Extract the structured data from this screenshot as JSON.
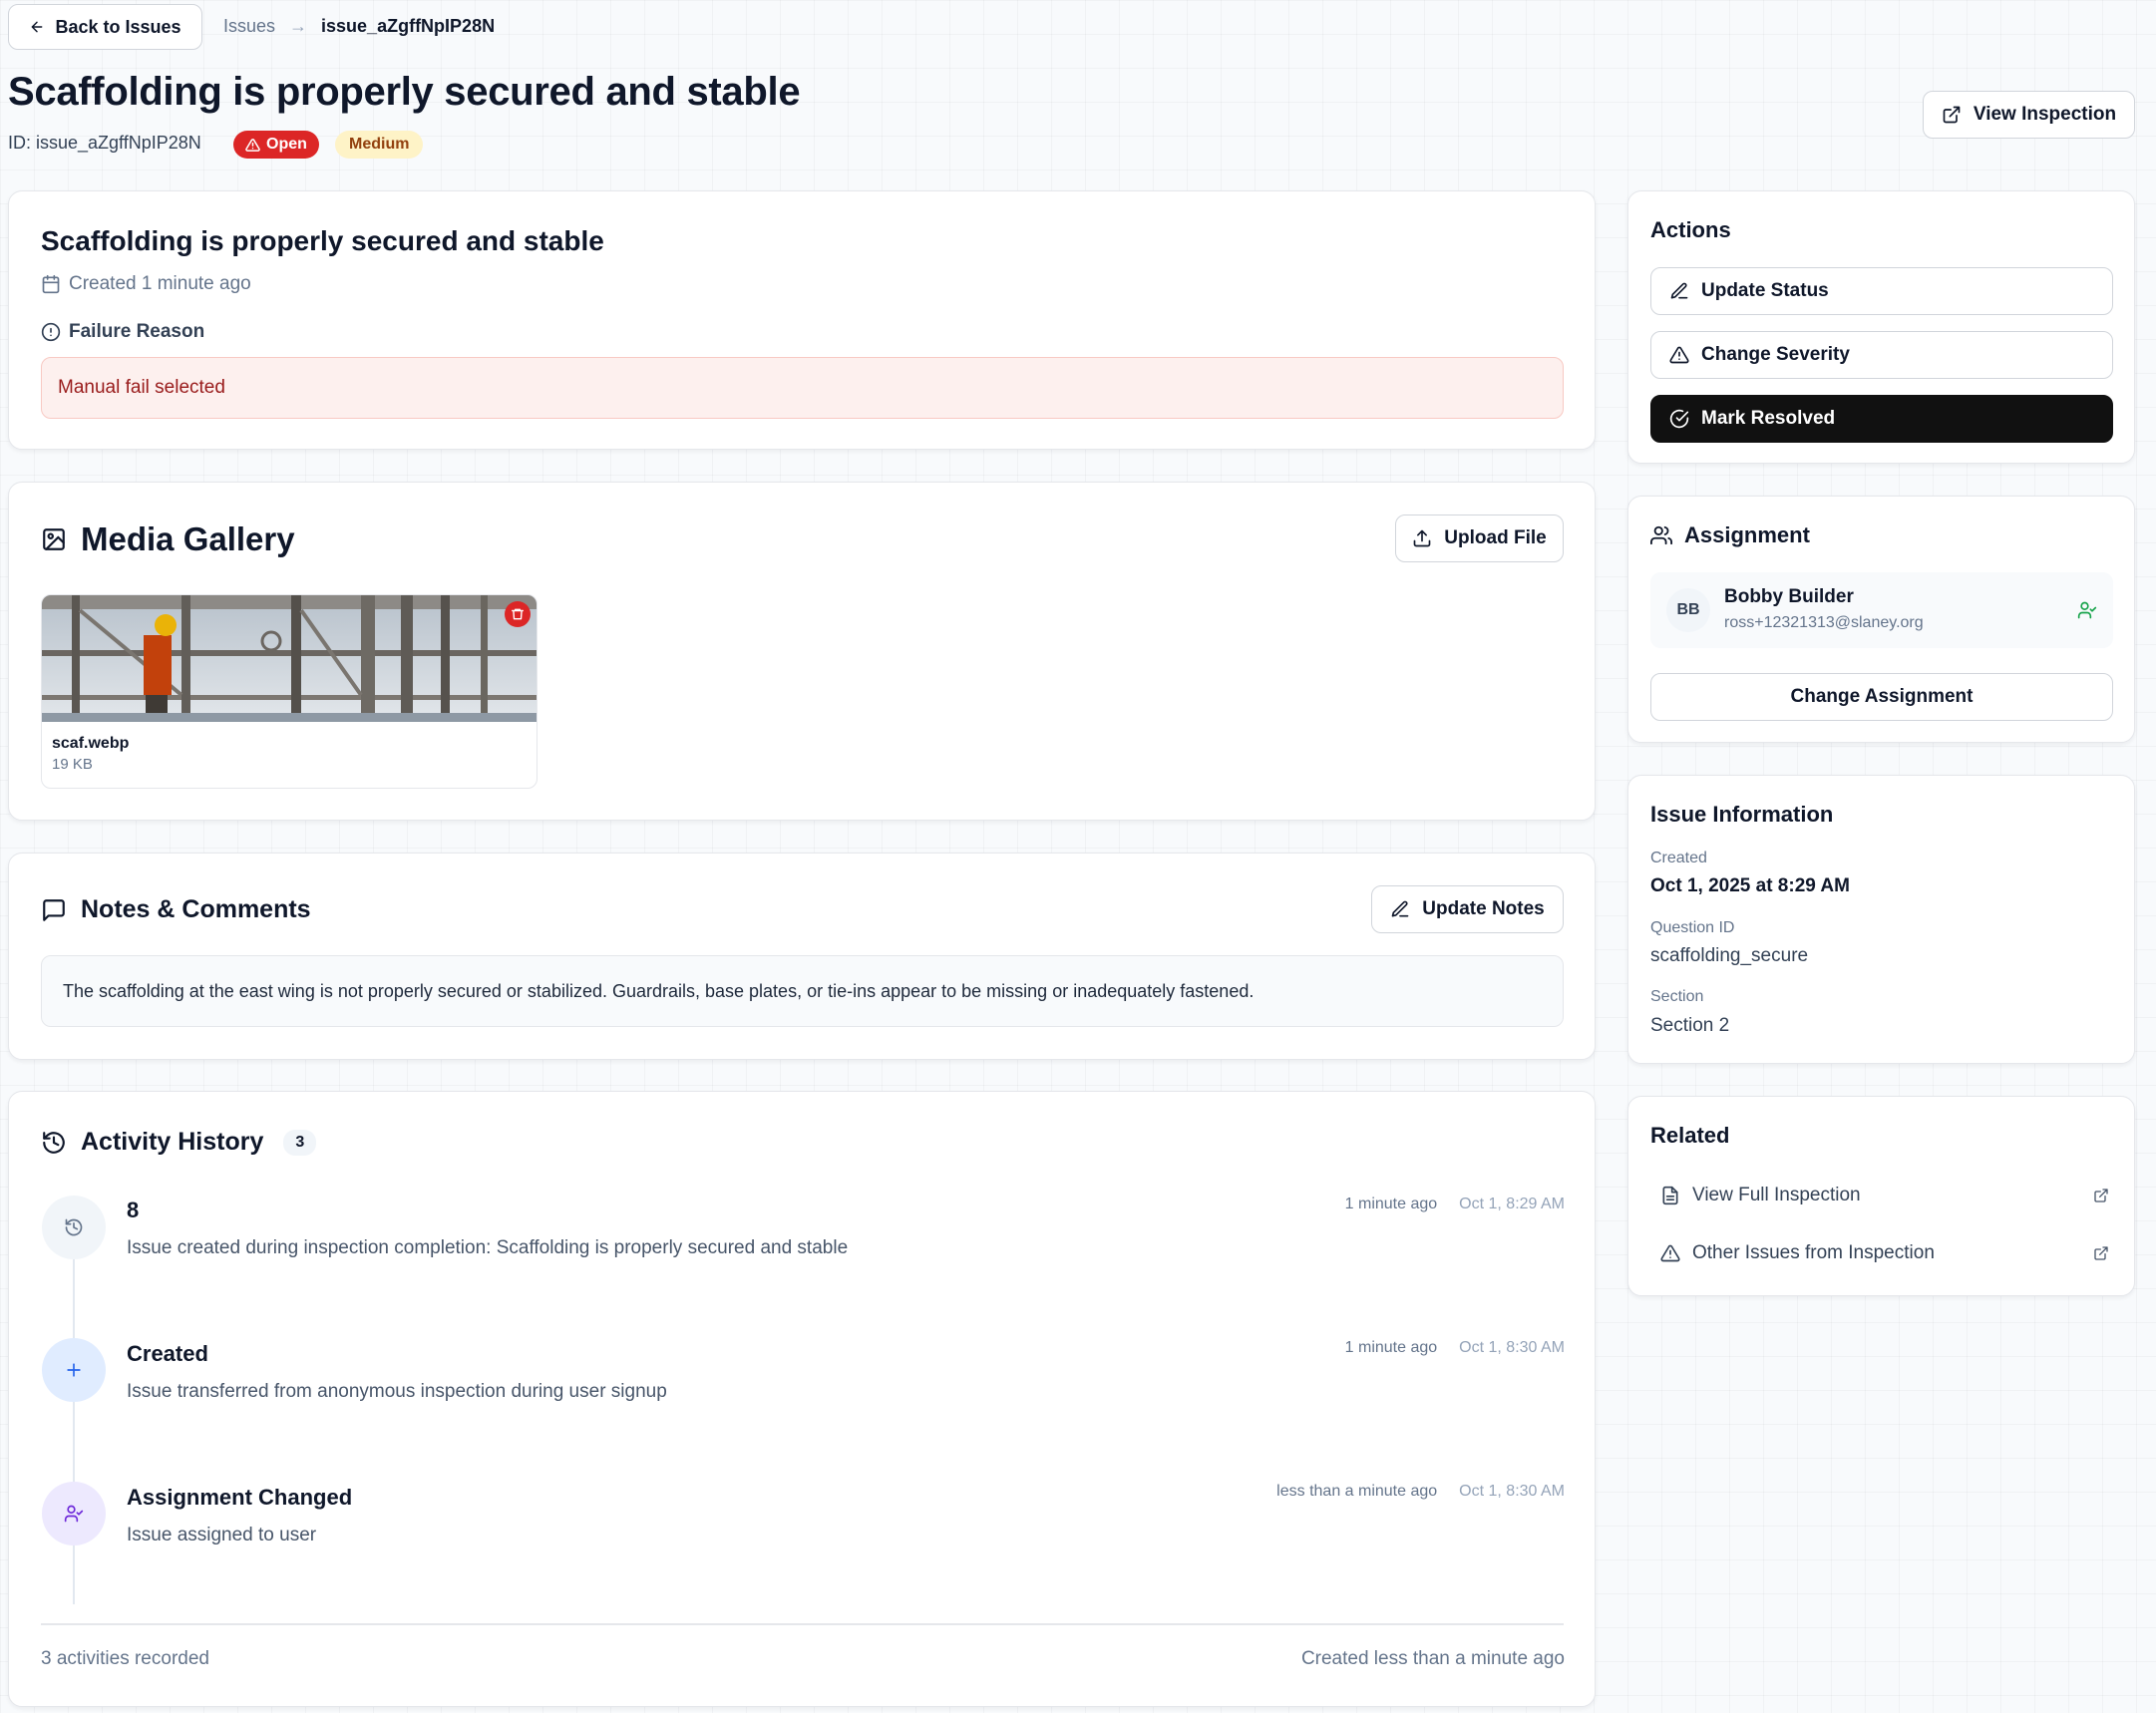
{
  "header": {
    "back_label": "Back to Issues",
    "breadcrumb_parent": "Issues",
    "breadcrumb_arrow": "→",
    "breadcrumb_current": "issue_aZgffNpIP28N",
    "title": "Scaffolding is properly secured and stable",
    "id_text": "ID: issue_aZgffNpIP28N",
    "status_badge": "Open",
    "severity_badge": "Medium",
    "view_inspection_label": "View Inspection"
  },
  "summary": {
    "title": "Scaffolding is properly secured and stable",
    "created": "Created 1 minute ago",
    "failure_reason_label": "Failure Reason",
    "failure_reason": "Manual fail selected"
  },
  "media": {
    "title": "Media Gallery",
    "upload_label": "Upload File",
    "file_name": "scaf.webp",
    "file_size": "19 KB"
  },
  "notes": {
    "title": "Notes & Comments",
    "update_label": "Update Notes",
    "text": "The scaffolding at the east wing is not properly secured or stabilized. Guardrails, base plates, or tie-ins appear to be missing or inadequately fastened."
  },
  "activity": {
    "title": "Activity History",
    "count": "3",
    "items": [
      {
        "title": "8",
        "desc": "Issue created during inspection completion: Scaffolding is properly secured and stable",
        "relative": "1 minute ago",
        "date": "Oct 1, 8:29 AM",
        "icon": "history-icon"
      },
      {
        "title": "Created",
        "desc": "Issue transferred from anonymous inspection during user signup",
        "relative": "1 minute ago",
        "date": "Oct 1, 8:30 AM",
        "icon": "plus-icon"
      },
      {
        "title": "Assignment Changed",
        "desc": "Issue assigned to user",
        "relative": "less than a minute ago",
        "date": "Oct 1, 8:30 AM",
        "icon": "user-check-icon"
      }
    ],
    "footer_left": "3 activities recorded",
    "footer_right": "Created less than a minute ago"
  },
  "actions": {
    "title": "Actions",
    "update_status": "Update Status",
    "change_severity": "Change Severity",
    "mark_resolved": "Mark Resolved"
  },
  "assignment": {
    "title": "Assignment",
    "initials": "BB",
    "name": "Bobby Builder",
    "email": "ross+12321313@slaney.org",
    "change_label": "Change Assignment"
  },
  "info": {
    "title": "Issue Information",
    "created_label": "Created",
    "created_value": "Oct 1, 2025 at 8:29 AM",
    "question_label": "Question ID",
    "question_value": "scaffolding_secure",
    "section_label": "Section",
    "section_value": "Section 2"
  },
  "related": {
    "title": "Related",
    "view_full": "View Full Inspection",
    "other_issues": "Other Issues from Inspection"
  },
  "colors": {
    "open_bg": "#dc2626",
    "medium_bg": "#fef3c7",
    "medium_text": "#92400e",
    "failure_bg": "#fdf0ee",
    "failure_text": "#991b1b",
    "primary_dark": "#111111",
    "success_green": "#16a34a"
  }
}
